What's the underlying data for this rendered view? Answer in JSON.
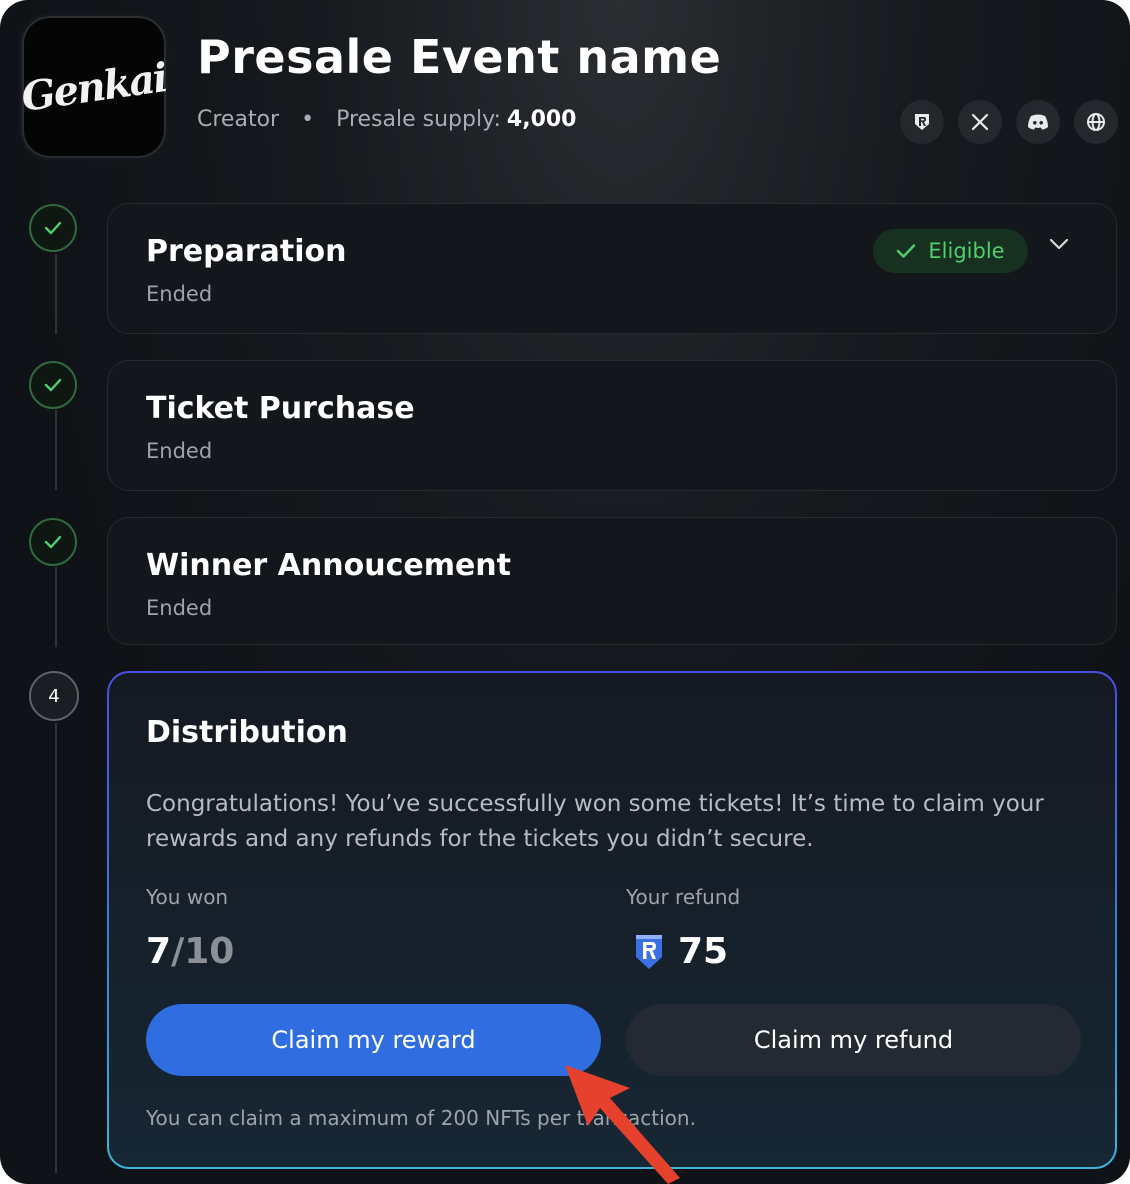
{
  "header": {
    "logo_text": "Genkai",
    "title": "Presale Event name",
    "creator_label": "Creator",
    "separator": "•",
    "supply_label": "Presale supply:",
    "supply_value": "4,000",
    "social_icons": [
      "shield-logo-icon",
      "x-icon",
      "discord-icon",
      "globe-icon"
    ]
  },
  "steps": [
    {
      "title": "Preparation",
      "status": "Ended",
      "badge": "Eligible",
      "state": "completed"
    },
    {
      "title": "Ticket Purchase",
      "status": "Ended",
      "state": "completed"
    },
    {
      "title": "Winner Annoucement",
      "status": "Ended",
      "state": "completed"
    }
  ],
  "distribution": {
    "step_number": "4",
    "title": "Distribution",
    "description": "Congratulations! You’ve successfully won some tickets! It’s time to claim your rewards and any refunds for the tickets you didn’t secure.",
    "won_label": "You won",
    "won_count": "7",
    "won_total": "/10",
    "refund_label": "Your refund",
    "refund_value": "75",
    "refund_token_icon": "token-shield-icon",
    "claim_reward_label": "Claim my reward",
    "claim_refund_label": "Claim my refund",
    "note": "You can claim a maximum of 200 NFTs per transaction."
  },
  "colors": {
    "background": "#0f1216",
    "accent_blue": "#2f6de0",
    "success_green": "#4fcf6e",
    "annotation_arrow": "#e5412d"
  }
}
